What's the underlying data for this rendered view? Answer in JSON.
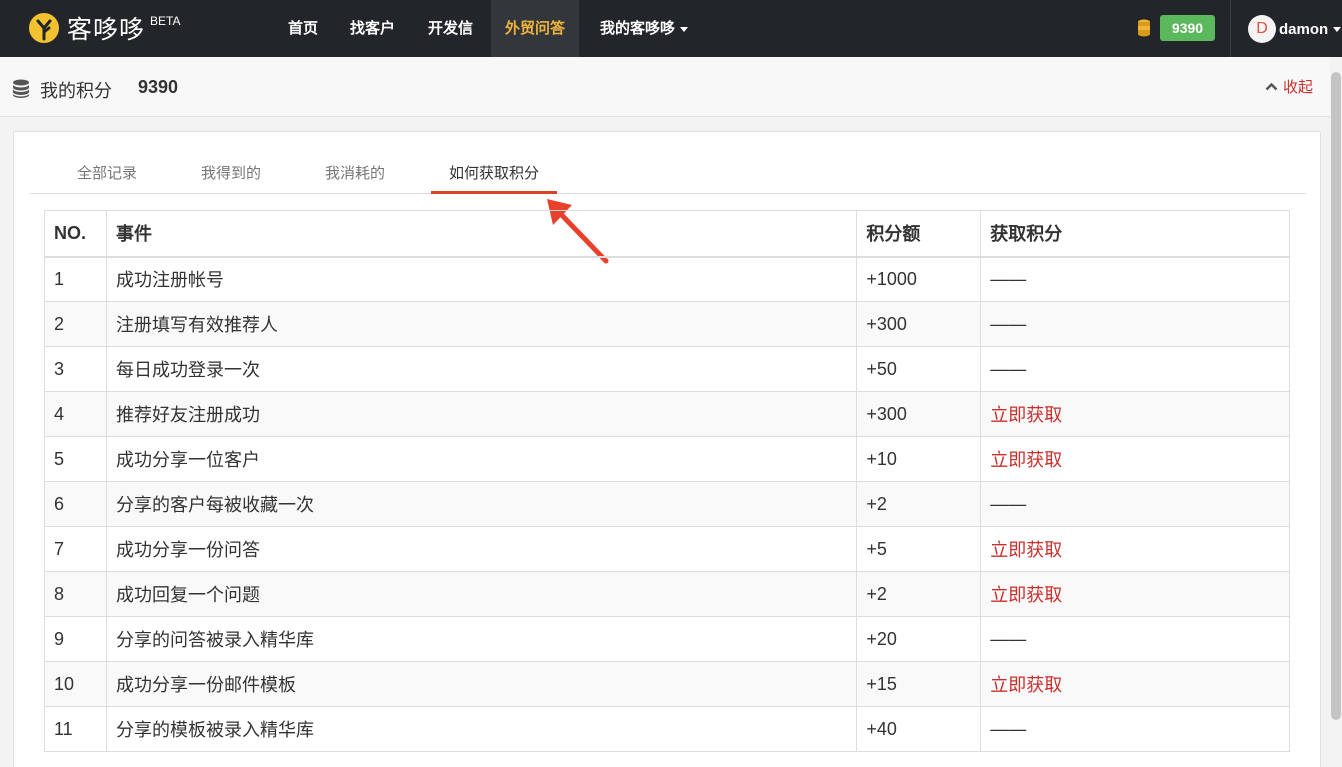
{
  "navbar": {
    "brand_name": "客哆哆",
    "brand_badge": "BETA",
    "links": [
      "首页",
      "找客户",
      "开发信",
      "外贸问答",
      "我的客哆哆"
    ],
    "active_link": "外贸问答",
    "points_badge": "9390",
    "user_avatar_letter": "D",
    "username": "damon"
  },
  "page_head": {
    "title": "我的积分",
    "points": "9390",
    "collapse_label": "收起"
  },
  "tabs": [
    {
      "label": "全部记录"
    },
    {
      "label": "我得到的"
    },
    {
      "label": "我消耗的"
    },
    {
      "label": "如何获取积分",
      "active": true
    }
  ],
  "table": {
    "headers": [
      "NO.",
      "事件",
      "积分额",
      "获取积分"
    ],
    "rows": [
      {
        "no": "1",
        "event": "成功注册帐号",
        "amount": "+1000",
        "action": "——",
        "action_link": false
      },
      {
        "no": "2",
        "event": "注册填写有效推荐人",
        "amount": "+300",
        "action": "——",
        "action_link": false
      },
      {
        "no": "3",
        "event": "每日成功登录一次",
        "amount": "+50",
        "action": "——",
        "action_link": false
      },
      {
        "no": "4",
        "event": "推荐好友注册成功",
        "amount": "+300",
        "action": "立即获取",
        "action_link": true
      },
      {
        "no": "5",
        "event": "成功分享一位客户",
        "amount": "+10",
        "action": "立即获取",
        "action_link": true
      },
      {
        "no": "6",
        "event": "分享的客户每被收藏一次",
        "amount": "+2",
        "action": "——",
        "action_link": false
      },
      {
        "no": "7",
        "event": "成功分享一份问答",
        "amount": "+5",
        "action": "立即获取",
        "action_link": true
      },
      {
        "no": "8",
        "event": "成功回复一个问题",
        "amount": "+2",
        "action": "立即获取",
        "action_link": true
      },
      {
        "no": "9",
        "event": "分享的问答被录入精华库",
        "amount": "+20",
        "action": "——",
        "action_link": false
      },
      {
        "no": "10",
        "event": "成功分享一份邮件模板",
        "amount": "+15",
        "action": "立即获取",
        "action_link": true
      },
      {
        "no": "11",
        "event": "分享的模板被录入精华库",
        "amount": "+40",
        "action": "——",
        "action_link": false
      }
    ]
  },
  "colors": {
    "navbar_bg": "#222529",
    "active_nav_text": "#f0b43c",
    "badge_green": "#5cb85c",
    "accent_red": "#c9302c",
    "tab_underline": "#d9432a"
  }
}
